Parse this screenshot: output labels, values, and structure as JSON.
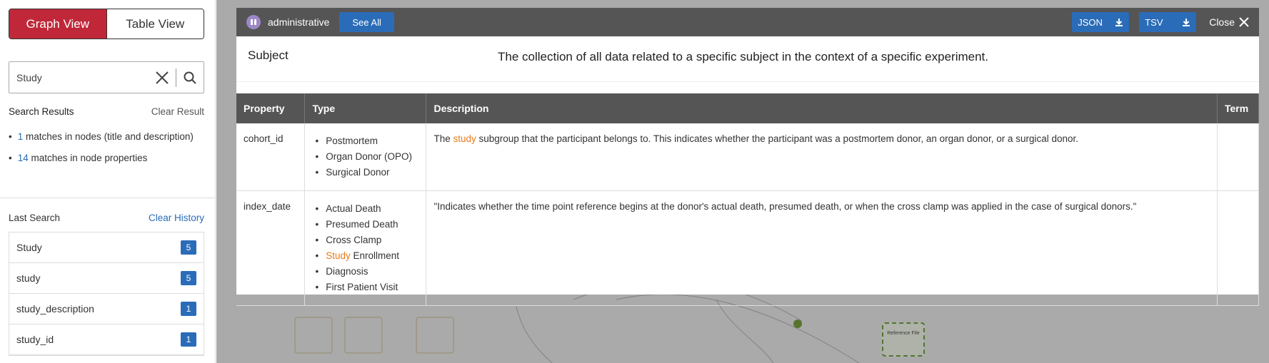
{
  "sidebar": {
    "view_tabs": {
      "graph": "Graph View",
      "table": "Table View"
    },
    "search": {
      "value": "Study"
    },
    "results": {
      "title": "Search Results",
      "clear_label": "Clear Result",
      "items": [
        {
          "count": "1",
          "text": " matches in nodes (title and description)"
        },
        {
          "count": "14",
          "text": " matches in node properties"
        }
      ]
    },
    "last_search": {
      "title": "Last Search",
      "clear_label": "Clear History",
      "items": [
        {
          "term": "Study",
          "count": "5"
        },
        {
          "term": "study",
          "count": "5"
        },
        {
          "term": "study_description",
          "count": "1"
        },
        {
          "term": "study_id",
          "count": "1"
        }
      ]
    }
  },
  "background": {
    "node_label": "Reference File"
  },
  "modal": {
    "category": "administrative",
    "see_all": "See All",
    "json_label": "JSON",
    "tsv_label": "TSV",
    "close_label": "Close",
    "node_name": "Subject",
    "node_description": "The collection of all data related to a specific subject in the context of a specific experiment.",
    "columns": [
      "Property",
      "Type",
      "Description",
      "Term"
    ],
    "rows": [
      {
        "property": "cohort_id",
        "types": [
          "Postmortem",
          "Organ Donor (OPO)",
          "Surgical Donor"
        ],
        "desc_pre": "The ",
        "desc_hl": "study",
        "desc_post": " subgroup that the participant belongs to. This indicates whether the participant was a postmortem donor, an organ donor, or a surgical donor."
      },
      {
        "property": "index_date",
        "types": [
          "Actual Death",
          "Presumed Death",
          "Cross Clamp",
          "Study Enrollment",
          "Diagnosis",
          "First Patient Visit"
        ],
        "type_hl": "Study",
        "type_hl_rest": " Enrollment",
        "description": "\"Indicates whether the time point reference begins at the donor's actual death, presumed death, or when the cross clamp was applied in the case of surgical donors.\""
      }
    ]
  },
  "colors": {
    "accent_red": "#c0283a",
    "link_blue": "#2a6cb8",
    "highlight_orange": "#e87a1a",
    "header_gray": "#555555"
  }
}
